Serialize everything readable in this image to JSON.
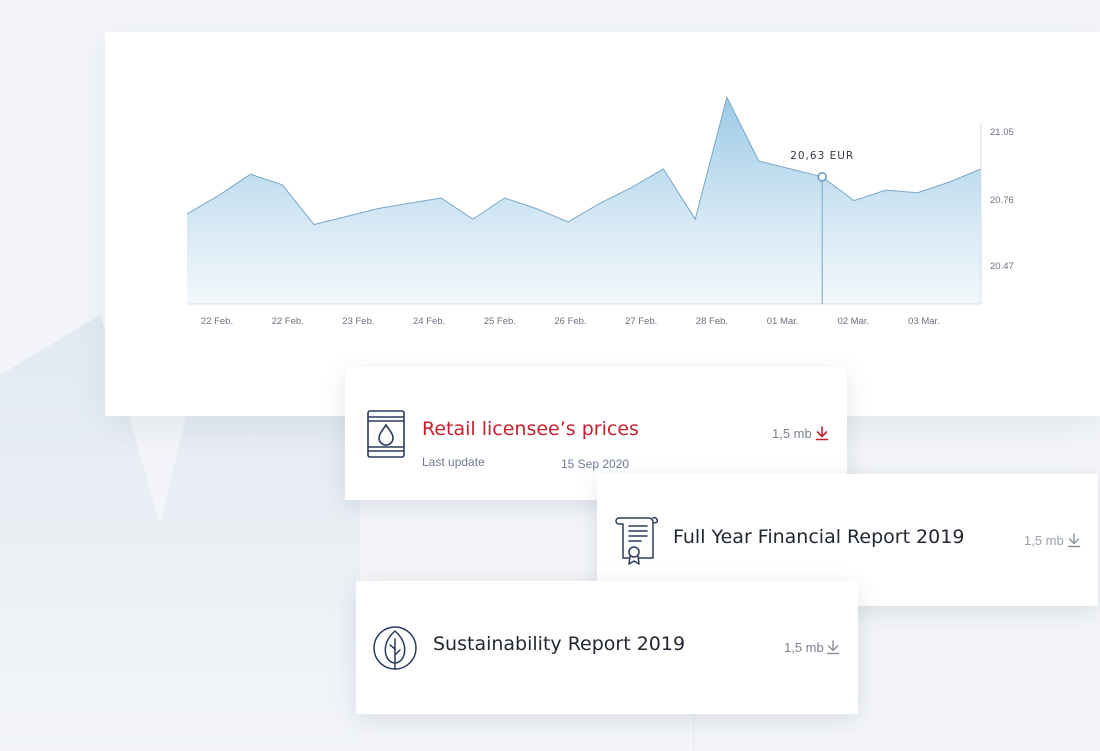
{
  "chart_data": {
    "type": "area",
    "x": [
      "22 Feb.",
      "22 Feb.",
      "23 Feb.",
      "24 Feb.",
      "25 Feb.",
      "26 Feb.",
      "27 Feb.",
      "28 Feb.",
      "01 Mar.",
      "02 Mar.",
      "03 Mar."
    ],
    "series": [
      {
        "values": [
          20.64,
          20.71,
          20.79,
          20.75,
          20.6,
          20.63,
          20.66,
          20.68,
          20.7,
          20.62,
          20.7,
          20.66,
          20.61,
          20.68,
          20.74,
          20.81,
          20.62,
          21.08,
          20.84,
          20.81,
          20.78,
          20.69,
          20.73,
          20.72,
          20.76,
          20.81
        ]
      }
    ],
    "y_ticks": [
      "21.05",
      "20.76",
      "20.47"
    ],
    "ylim": [
      20.3,
      21.1
    ],
    "grid": false,
    "tooltip": {
      "label": "20,63 EUR",
      "x_label": "02 Mar."
    },
    "fill_color": "#a6cfe8",
    "line_color": "#7aa7c8"
  },
  "files": [
    {
      "id": "retail",
      "title": "Retail licensee’s prices",
      "title_color": "#c8202f",
      "size": "1,5 mb",
      "meta_label": "Last update",
      "meta_date": "15 Sep 2020",
      "icon": "oil-barrel-icon",
      "download_icon": "download-icon"
    },
    {
      "id": "financial",
      "title": "Full Year Financial Report 2019",
      "size": "1,5 mb",
      "icon": "certificate-document-icon",
      "download_icon": "download-icon"
    },
    {
      "id": "sustain",
      "title": "Sustainability Report 2019",
      "size": "1,5 mb",
      "icon": "leaf-icon",
      "download_icon": "download-icon"
    }
  ],
  "colors": {
    "accent_red": "#c8202f",
    "icon_navy": "#2a3b5c"
  }
}
